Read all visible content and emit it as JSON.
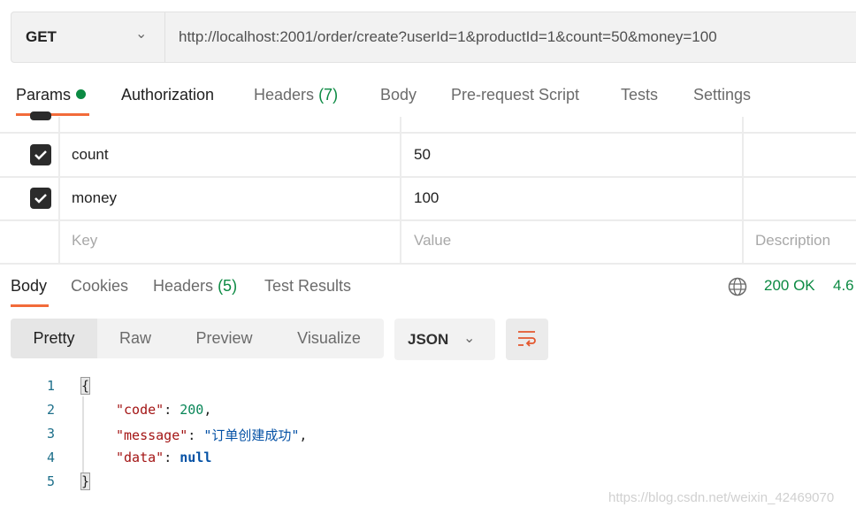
{
  "request": {
    "method": "GET",
    "url": "http://localhost:2001/order/create?userId=1&productId=1&count=50&money=100"
  },
  "request_tabs": [
    {
      "label": "Params"
    },
    {
      "label": "Authorization"
    },
    {
      "label": "Headers",
      "count": "(7)"
    },
    {
      "label": "Body"
    },
    {
      "label": "Pre-request Script"
    },
    {
      "label": "Tests"
    },
    {
      "label": "Settings"
    }
  ],
  "params": {
    "rows": [
      {
        "key": "count",
        "value": "50",
        "checked": true
      },
      {
        "key": "money",
        "value": "100",
        "checked": true
      }
    ],
    "placeholder": {
      "key": "Key",
      "value": "Value",
      "description": "Description"
    }
  },
  "response_tabs": [
    {
      "label": "Body"
    },
    {
      "label": "Cookies"
    },
    {
      "label": "Headers",
      "count": "(5)"
    },
    {
      "label": "Test Results"
    }
  ],
  "status": {
    "code": "200 OK",
    "time": "4.6"
  },
  "view_modes": [
    "Pretty",
    "Raw",
    "Preview",
    "Visualize"
  ],
  "format": "JSON",
  "code_lines": {
    "numbers": [
      "1",
      "2",
      "3",
      "4",
      "5"
    ],
    "open": "{",
    "close": "}",
    "code_key": "\"code\"",
    "code_val": "200",
    "message_key": "\"message\"",
    "message_val": "\"订单创建成功\"",
    "data_key": "\"data\"",
    "data_val": "null"
  },
  "watermark": "https://blog.csdn.net/weixin_42469070",
  "colors": {
    "accent": "#f26b3a",
    "success": "#0c8a43"
  }
}
